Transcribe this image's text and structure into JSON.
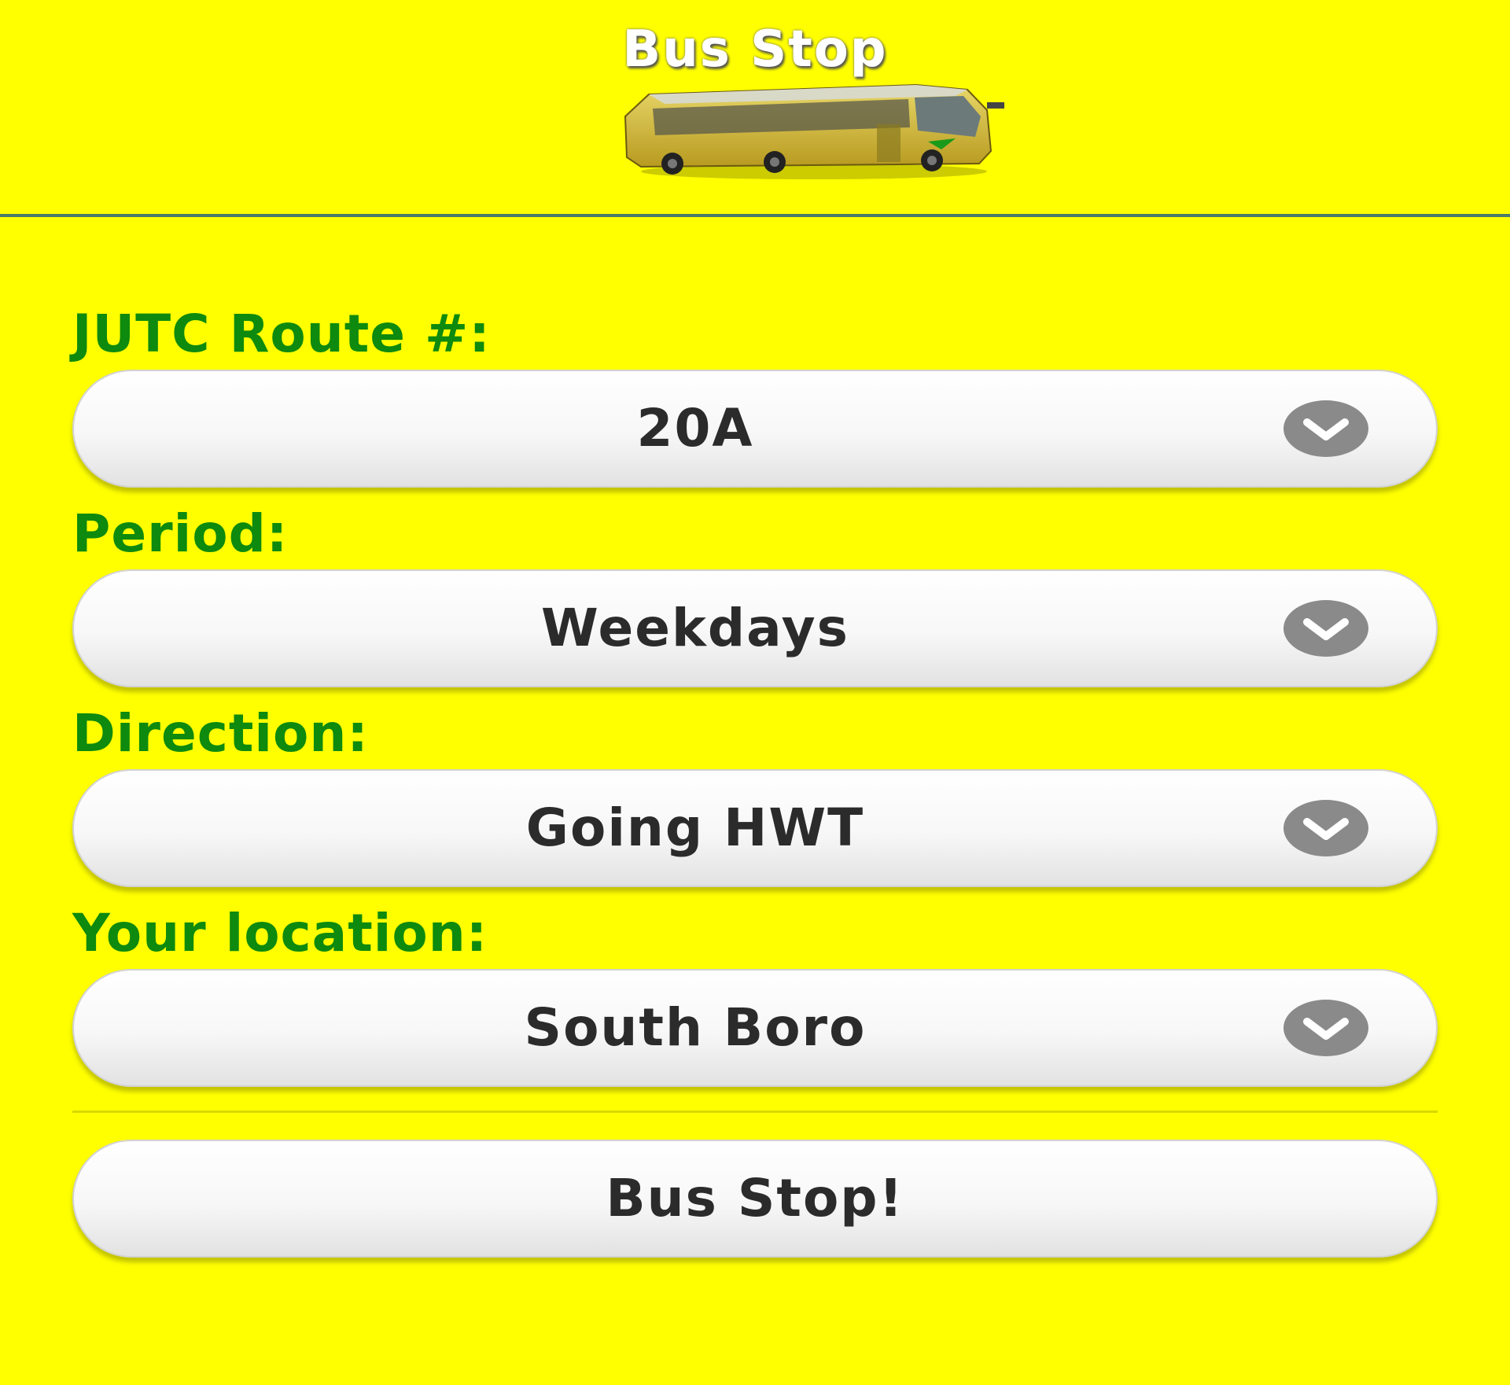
{
  "header": {
    "title": "Bus Stop",
    "logo_icon": "bus-icon"
  },
  "form": {
    "fields": [
      {
        "label": "JUTC Route #:",
        "value": "20A"
      },
      {
        "label": "Period:",
        "value": "Weekdays"
      },
      {
        "label": "Direction:",
        "value": "Going HWT"
      },
      {
        "label": "Your location:",
        "value": "South Boro"
      }
    ],
    "submit_label": "Bus Stop!"
  },
  "colors": {
    "background": "#ffff00",
    "label": "#0e8a0e",
    "value_text": "#2b2b2b",
    "chevron": "#8a8a8a"
  }
}
